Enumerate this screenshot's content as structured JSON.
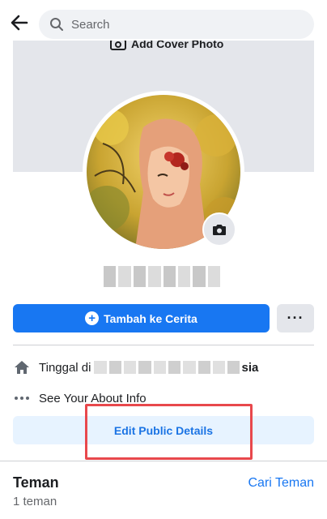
{
  "search": {
    "placeholder": "Search"
  },
  "cover": {
    "label": "Add Cover Photo"
  },
  "buttons": {
    "add_story": "Tambah ke Cerita",
    "more": "···",
    "edit_public_details": "Edit Public Details"
  },
  "about": {
    "lives_in_prefix": "Tinggal di",
    "lives_in_suffix": "sia",
    "see_about": "See Your About Info"
  },
  "friends": {
    "title": "Teman",
    "find_link": "Cari Teman",
    "count": "1 teman"
  },
  "colors": {
    "accent": "#1877f2",
    "highlight": "#e8484c"
  }
}
